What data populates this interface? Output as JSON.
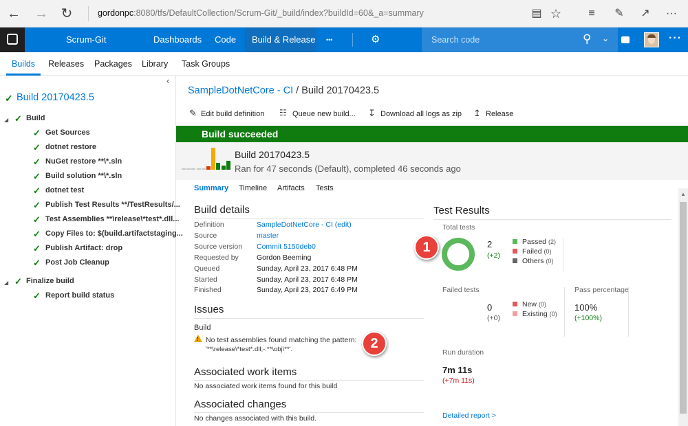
{
  "browser": {
    "url_host": "gordonpc",
    "url_rest": ":8080/tfs/DefaultCollection/Scrum-Git/_build/index?buildId=60&_a=summary"
  },
  "topnav": {
    "project": "Scrum-Git",
    "items": [
      "Dashboards",
      "Code",
      "Build & Release",
      "•••"
    ],
    "search_placeholder": "Search code"
  },
  "subnav": {
    "items": [
      "Builds",
      "Releases",
      "Packages",
      "Library",
      "Task Groups"
    ]
  },
  "tree": {
    "title": "Build 20170423.5",
    "items": [
      {
        "label": "Build",
        "level": 0
      },
      {
        "label": "Get Sources",
        "level": 1
      },
      {
        "label": "dotnet restore",
        "level": 1
      },
      {
        "label": "NuGet restore **\\*.sln",
        "level": 1
      },
      {
        "label": "Build solution **\\*.sln",
        "level": 1
      },
      {
        "label": "dotnet test",
        "level": 1
      },
      {
        "label": "Publish Test Results **/TestResults/...",
        "level": 1
      },
      {
        "label": "Test Assemblies **\\release\\*test*.dll...",
        "level": 1
      },
      {
        "label": "Copy Files to: $(build.artifactstaging...",
        "level": 1
      },
      {
        "label": "Publish Artifact: drop",
        "level": 1
      },
      {
        "label": "Post Job Cleanup",
        "level": 1
      },
      {
        "label": "Finalize build",
        "level": 0
      },
      {
        "label": "Report build status",
        "level": 1
      }
    ]
  },
  "breadcrumb": {
    "definition": "SampleDotNetCore - CI",
    "separator": " / ",
    "build": "Build 20170423.5"
  },
  "toolbar": {
    "edit": "Edit build definition",
    "queue": "Queue new build...",
    "download": "Download all logs as zip",
    "release": "Release"
  },
  "banner": {
    "status": "Build succeeded"
  },
  "summary": {
    "title": "Build 20170423.5",
    "subtitle": "Ran for 47 seconds (Default), completed 46 seconds ago",
    "history_bars": [
      {
        "h": 0.05,
        "color": "#c8c8c8"
      },
      {
        "h": 0.05,
        "color": "#c8c8c8"
      },
      {
        "h": 0.05,
        "color": "#c8c8c8"
      },
      {
        "h": 0.05,
        "color": "#c8c8c8"
      },
      {
        "h": 0.05,
        "color": "#c8c8c8"
      },
      {
        "h": 0.15,
        "color": "#d83b01"
      },
      {
        "h": 1.0,
        "color": "#f2a900"
      },
      {
        "h": 0.3,
        "color": "#107c10"
      },
      {
        "h": 0.2,
        "color": "#107c10"
      },
      {
        "h": 0.4,
        "color": "#107c10"
      }
    ]
  },
  "tabs": [
    "Summary",
    "Timeline",
    "Artifacts",
    "Tests"
  ],
  "build_details": {
    "heading": "Build details",
    "rows": [
      {
        "label": "Definition",
        "value": "SampleDotNetCore - CI (edit)",
        "link": true
      },
      {
        "label": "Source",
        "value": "master",
        "link": true
      },
      {
        "label": "Source version",
        "value": "Commit 5150deb0",
        "link": true
      },
      {
        "label": "Requested by",
        "value": "Gordon Beeming",
        "link": false
      },
      {
        "label": "Queued",
        "value": "Sunday, April 23, 2017 6:48 PM",
        "link": false
      },
      {
        "label": "Started",
        "value": "Sunday, April 23, 2017 6:48 PM",
        "link": false
      },
      {
        "label": "Finished",
        "value": "Sunday, April 23, 2017 6:49 PM",
        "link": false
      }
    ]
  },
  "issues": {
    "heading": "Issues",
    "group": "Build",
    "message_line1": "No test assemblies found matching the pattern:",
    "message_line2": "'**\\release\\*test*.dll;-:**\\obj\\**'."
  },
  "work_items": {
    "heading": "Associated work items",
    "text": "No associated work items found for this build"
  },
  "changes": {
    "heading": "Associated changes",
    "text": "No changes associated with this build."
  },
  "test_results": {
    "heading": "Test Results",
    "total_label": "Total tests",
    "total": "2",
    "total_delta": "(+2)",
    "legend": [
      {
        "label": "Passed",
        "count": "(2)",
        "color": "#5cb85c"
      },
      {
        "label": "Failed",
        "count": "(0)",
        "color": "#e05a5a"
      },
      {
        "label": "Others",
        "count": "(0)",
        "color": "#666666"
      }
    ],
    "failed_label": "Failed tests",
    "failed": "0",
    "failed_delta": "(+0)",
    "failed_legend": [
      {
        "label": "New",
        "count": "(0)",
        "color": "#e05a5a"
      },
      {
        "label": "Existing",
        "count": "(0)",
        "color": "#f2a0a0"
      }
    ],
    "pass_label": "Pass percentage",
    "pass": "100%",
    "pass_delta": "(+100%)",
    "duration_label": "Run duration",
    "duration": "7m 11s",
    "duration_delta": "(+7m 11s)",
    "detailed_link": "Detailed report >",
    "passed_fraction": 1.0
  },
  "callouts": [
    "1",
    "2"
  ],
  "colors": {
    "accent": "#0078d7",
    "success": "#107c10",
    "callout": "#e8403b"
  }
}
